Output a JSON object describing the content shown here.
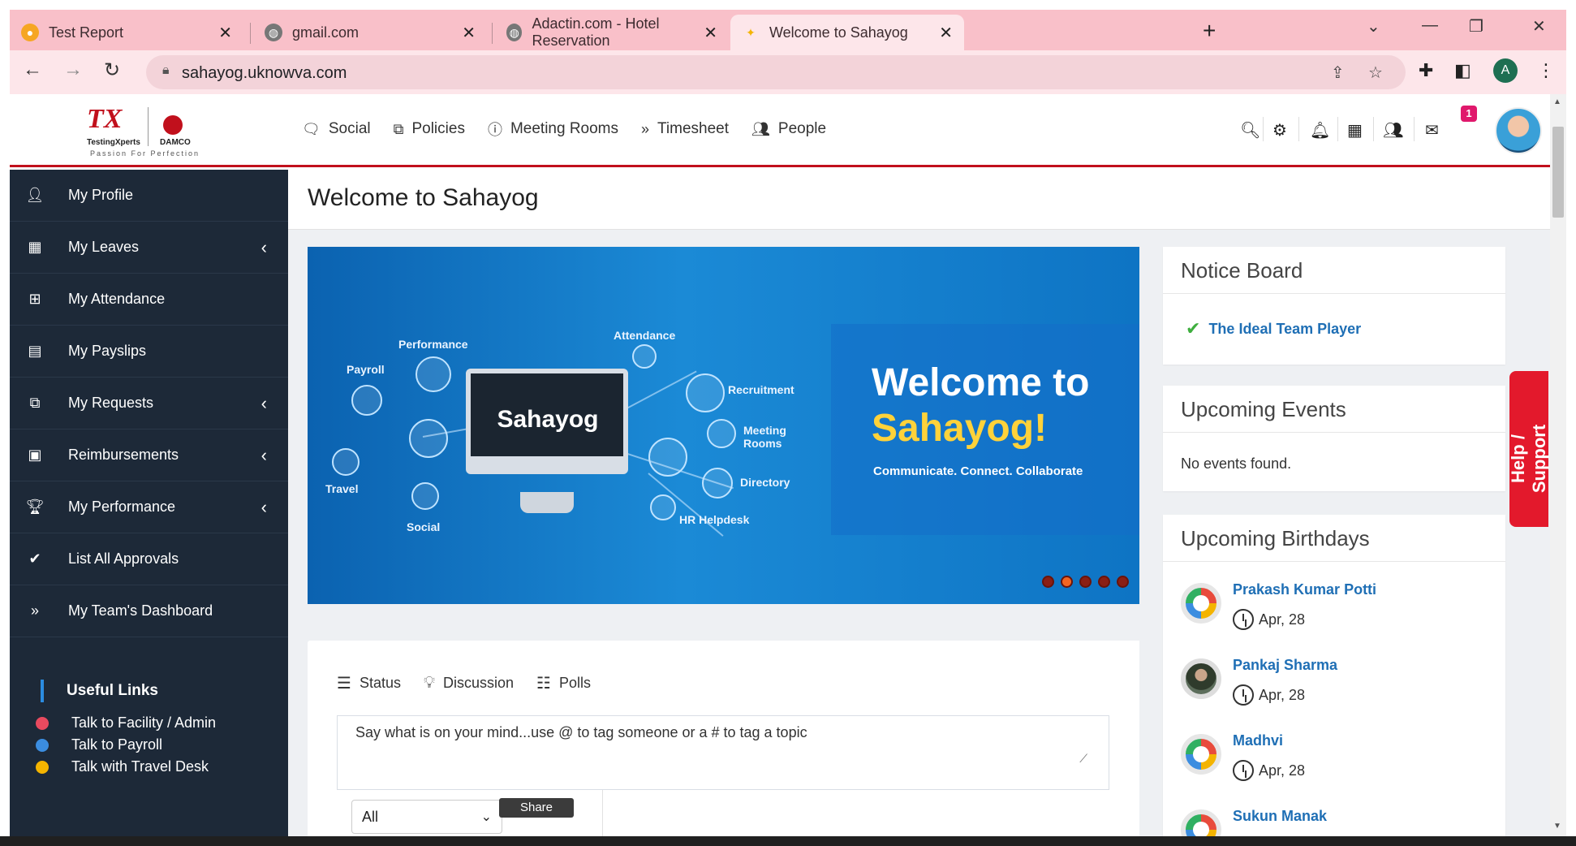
{
  "browser": {
    "tabs": [
      {
        "title": "Test Report"
      },
      {
        "title": "gmail.com"
      },
      {
        "title": "Adactin.com - Hotel Reservation"
      },
      {
        "title": "Welcome to Sahayog"
      }
    ],
    "url": "sahayog.uknowva.com",
    "profile_initial": "A"
  },
  "header": {
    "logo_tx": "TX",
    "logo_brand": "TestingXperts",
    "logo_partner": "DAMCO",
    "logo_tagline": "Passion For Perfection",
    "nav": [
      {
        "label": "Social",
        "icon": "chat-icon"
      },
      {
        "label": "Policies",
        "icon": "copy-icon"
      },
      {
        "label": "Meeting Rooms",
        "icon": "info-icon"
      },
      {
        "label": "Timesheet",
        "icon": "double-chevron-icon"
      },
      {
        "label": "People",
        "icon": "users-icon"
      }
    ],
    "mail_badge": "1"
  },
  "sidebar": {
    "items": [
      {
        "label": "My Profile",
        "icon": "user-icon",
        "has_submenu": false
      },
      {
        "label": "My Leaves",
        "icon": "calendar-icon",
        "has_submenu": true
      },
      {
        "label": "My Attendance",
        "icon": "calendar-plus-icon",
        "has_submenu": false
      },
      {
        "label": "My Payslips",
        "icon": "document-icon",
        "has_submenu": false
      },
      {
        "label": "My Requests",
        "icon": "copy-icon",
        "has_submenu": true
      },
      {
        "label": "Reimbursements",
        "icon": "money-icon",
        "has_submenu": true
      },
      {
        "label": "My Performance",
        "icon": "trophy-icon",
        "has_submenu": true
      },
      {
        "label": "List All Approvals",
        "icon": "check-icon",
        "has_submenu": false
      },
      {
        "label": "My Team's Dashboard",
        "icon": "double-chevron-icon",
        "has_submenu": false
      }
    ],
    "useful_links_title": "Useful Links",
    "useful_links": [
      {
        "label": "Talk to Facility / Admin",
        "color": "#e84a5f"
      },
      {
        "label": "Talk to Payroll",
        "color": "#3b8de0"
      },
      {
        "label": "Talk with Travel Desk",
        "color": "#f4b400"
      }
    ]
  },
  "main": {
    "page_title": "Welcome to Sahayog",
    "banner": {
      "monitor_label": "Sahayog",
      "welcome_line1": "Welcome to",
      "welcome_line2": "Sahayog!",
      "tagline": "Communicate. Connect. Collaborate",
      "nodes": [
        "Performance",
        "Payroll",
        "Attendance",
        "Recruitment",
        "Meeting Rooms",
        "Directory",
        "HR Helpdesk",
        "Travel",
        "Social"
      ],
      "slide_count": 5,
      "active_slide": 2
    },
    "post": {
      "tabs": [
        "Status",
        "Discussion",
        "Polls"
      ],
      "placeholder": "Say what is on your mind...use @ to tag someone or a # to tag a topic",
      "visibility": "All",
      "share_label": "Share"
    },
    "notice_board": {
      "title": "Notice Board",
      "items": [
        "The Ideal Team Player"
      ]
    },
    "upcoming_events": {
      "title": "Upcoming Events",
      "empty_text": "No events found."
    },
    "upcoming_birthdays": {
      "title": "Upcoming Birthdays",
      "people": [
        {
          "name": "Prakash Kumar Potti",
          "date": "Apr, 28"
        },
        {
          "name": "Pankaj Sharma",
          "date": "Apr, 28"
        },
        {
          "name": "Madhvi",
          "date": "Apr, 28"
        },
        {
          "name": "Sukun Manak",
          "date": ""
        }
      ]
    },
    "help_tab": "Help / Support"
  }
}
